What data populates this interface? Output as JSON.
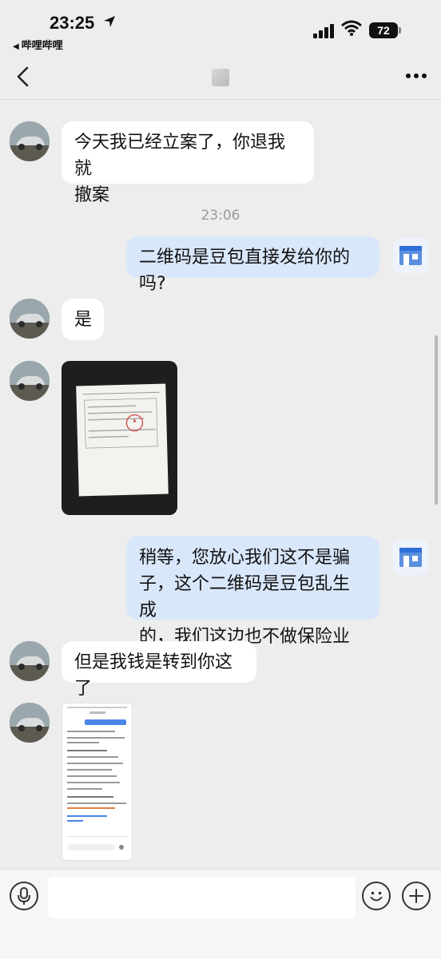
{
  "status_bar": {
    "time": "23:25",
    "back_app": "哔哩哔哩",
    "battery": "72"
  },
  "nav": {
    "back_icon": "chevron-left-icon",
    "more_icon": "more-dots-icon"
  },
  "messages": [
    {
      "side": "left",
      "text_lines": [
        "今天我已经立案了，你退我就",
        "撤案"
      ]
    },
    {
      "timestamp": "23:06"
    },
    {
      "side": "right",
      "text_lines": [
        "二维码是豆包直接发给你的吗?"
      ]
    },
    {
      "side": "left",
      "text_lines": [
        "是"
      ]
    },
    {
      "side": "left",
      "type": "image",
      "description": "document-photo"
    },
    {
      "side": "right",
      "text_lines": [
        "稍等，您放心我们这不是骗",
        "子，这个二维码是豆包乱生成",
        "的，我们这边也不做保险业务"
      ]
    },
    {
      "side": "left",
      "text_lines": [
        "但是我钱是转到你这了"
      ]
    },
    {
      "side": "left",
      "type": "image",
      "description": "screenshot"
    }
  ],
  "input_bar": {
    "voice_icon": "voice-icon",
    "emoji_icon": "emoji-icon",
    "plus_icon": "plus-icon",
    "placeholder": ""
  },
  "colors": {
    "background": "#ededed",
    "bubble_left": "#ffffff",
    "bubble_right": "#d9e7fb"
  }
}
